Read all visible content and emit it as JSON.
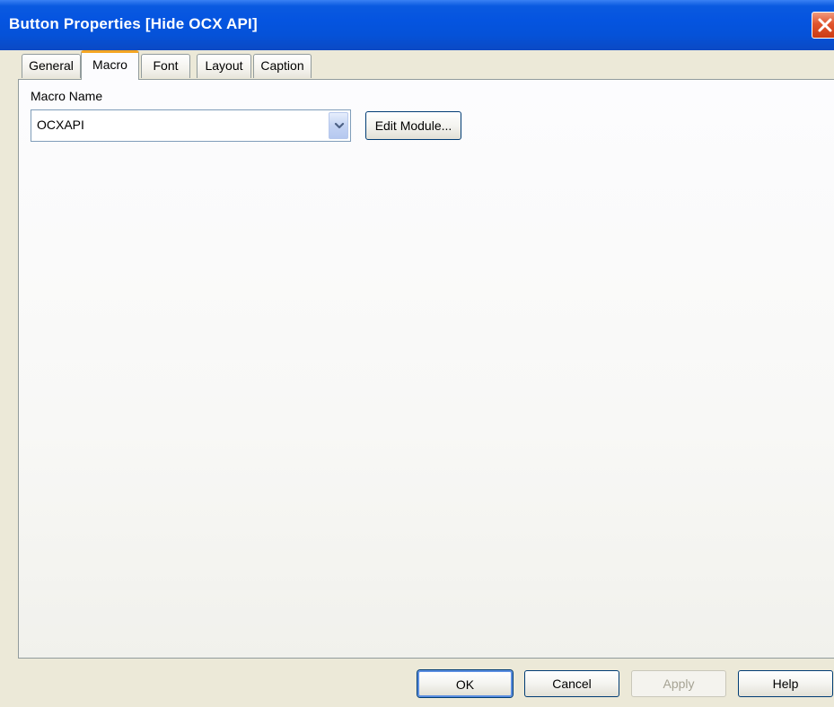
{
  "window": {
    "title": "Button Properties [Hide OCX API]"
  },
  "tabs": [
    {
      "label": "General",
      "active": false
    },
    {
      "label": "Macro",
      "active": true
    },
    {
      "label": "Font",
      "active": false
    },
    {
      "label": "Layout",
      "active": false
    },
    {
      "label": "Caption",
      "active": false
    }
  ],
  "macro": {
    "label": "Macro Name",
    "value": "OCXAPI",
    "edit_button": "Edit Module..."
  },
  "footer": {
    "ok": "OK",
    "cancel": "Cancel",
    "apply": "Apply",
    "help": "Help"
  },
  "icons": {
    "close": "close-icon",
    "dropdown": "chevron-down-icon"
  },
  "colors": {
    "titlebar": "#0554e0",
    "close": "#e0542d",
    "active_tab_accent": "#f5a623",
    "dialog_bg": "#ece9d8"
  }
}
